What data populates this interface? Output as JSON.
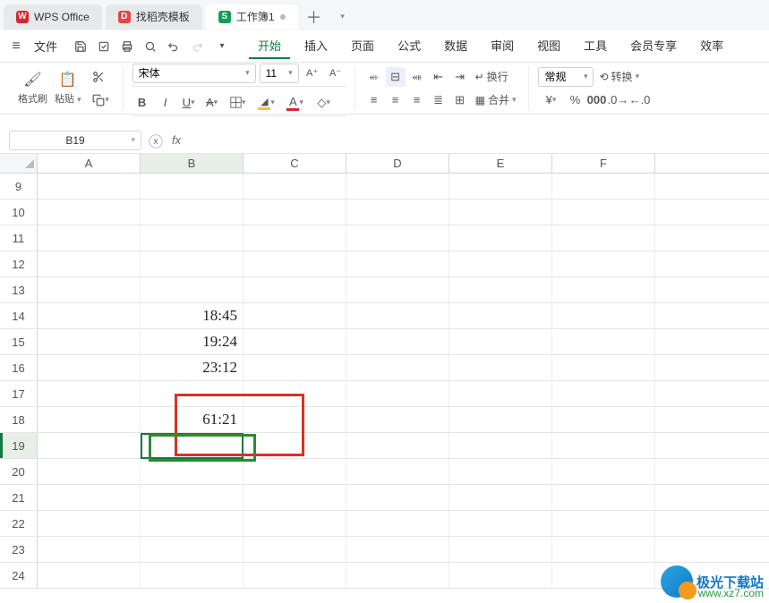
{
  "tabs": {
    "wps": "WPS Office",
    "daoke": "找稻壳模板",
    "workbook": "工作簿1"
  },
  "file_label": "文件",
  "menus": {
    "start": "开始",
    "insert": "插入",
    "page": "页面",
    "formula": "公式",
    "data": "数据",
    "review": "审阅",
    "view": "视图",
    "tools": "工具",
    "member": "会员专享",
    "efficiency": "效率"
  },
  "ribbon": {
    "format_brush": "格式刷",
    "paste": "粘贴",
    "font_name": "宋体",
    "font_size": "11",
    "wrap": "换行",
    "merge": "合并",
    "number_format": "常规",
    "convert": "转换"
  },
  "namebox": "B19",
  "columns": [
    "A",
    "B",
    "C",
    "D",
    "E",
    "F"
  ],
  "rows": [
    "9",
    "10",
    "11",
    "12",
    "13",
    "14",
    "15",
    "16",
    "17",
    "18",
    "19",
    "20",
    "21",
    "22",
    "23",
    "24"
  ],
  "cells": {
    "B14": "18:45",
    "B15": "19:24",
    "B16": "23:12",
    "B18": "61:21"
  },
  "watermark": {
    "name": "极光下载站",
    "url": "www.xz7.com"
  }
}
